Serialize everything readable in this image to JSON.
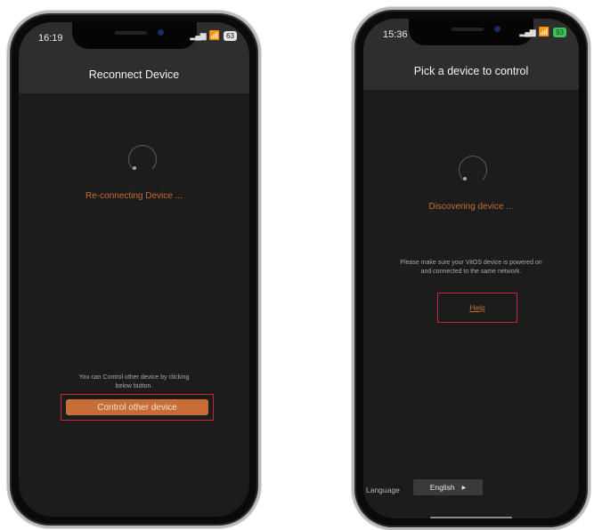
{
  "left_phone": {
    "status_time": "16:19",
    "battery": "63",
    "title": "Reconnect Device",
    "status_message": "Re-connecting Device ...",
    "info_line1": "You can Control other device by clicking",
    "info_line2": "below button.",
    "control_button_label": "Control other device"
  },
  "right_phone": {
    "status_time": "15:36",
    "battery": "93",
    "title": "Pick a device to control",
    "status_message": "Discovering device ...",
    "info_line1": "Please make sure your VitOS device is powered on",
    "info_line2": "and connected to the same network.",
    "help_link": "Help",
    "language_label": "Language",
    "language_value": "English"
  },
  "icons": {
    "signal": "signal-bars-icon",
    "wifi": "wifi-icon",
    "battery": "battery-icon",
    "spinner": "loading-spinner-icon",
    "dropdown": "triangle-right-icon"
  },
  "colors": {
    "accent_orange": "#c66e36",
    "highlight_red": "#c4253a",
    "screen_bg": "#1c1c1c",
    "header_bg": "#2e2e2e"
  }
}
